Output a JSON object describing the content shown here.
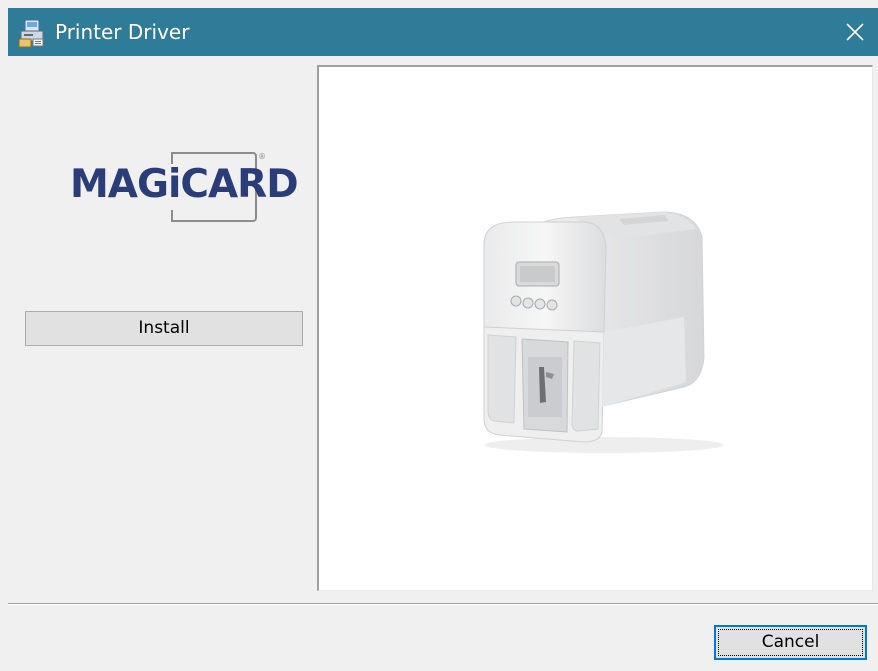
{
  "window": {
    "title": "Printer Driver",
    "icon": "installer-icon",
    "close_icon": "close-icon"
  },
  "left_panel": {
    "logo_text": "MAGiCARD",
    "install_label": "Install"
  },
  "preview": {
    "image": "card-printer-image"
  },
  "footer": {
    "cancel_label": "Cancel"
  },
  "colors": {
    "titlebar": "#2f7c98",
    "logo_blue": "#2b3d78",
    "logo_gray": "#8a8c8f",
    "focus_border": "#0078d7"
  }
}
